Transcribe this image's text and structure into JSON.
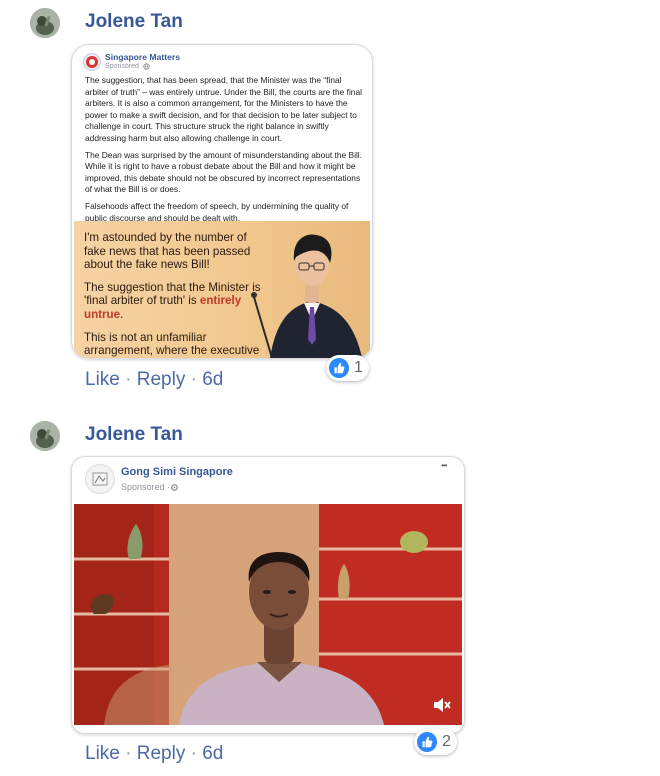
{
  "comments": [
    {
      "author": "Jolene Tan",
      "actions": {
        "like": "Like",
        "reply": "Reply",
        "time": "6d",
        "dot": "·"
      },
      "reaction_count": "1",
      "shared_post": {
        "page_name": "Singapore Matters",
        "sponsored": "Sponsored · ",
        "paragraphs": [
          "The suggestion, that has been spread, that the Minister was the “final arbiter of truth” – was entirely untrue. Under the Bill, the courts are the final arbiters. It is also a common arrangement, for the Ministers to have the power to make a swift decision, and for that decision to be later subject to challenge in court. This structure struck the right balance in swiftly addressing harm but also allowing challenge in court.",
          "The Dean was surprised by the amount of misunderstanding about the Bill. While it is right to have a robust debate about the Bill and how it might be improved, this debate should not be obscured by incorrect representations of what the Bill is or does.",
          "Falsehoods affect the freedom of speech, by undermining the quality of public discourse and should be dealt with."
        ],
        "quote": {
          "p1": "I'm astounded by the number of fake news that has been passed about the fake news Bill!",
          "p2_prefix": "The suggestion that the Minister is 'final arbiter of truth' is ",
          "p2_highlight": "entirely untrue",
          "p2_suffix": ".",
          "p3": "This is not an unfamiliar arrangement, where the executive (branch) has power to make a swift decision, and then the decision can be challenged in court."
        }
      }
    },
    {
      "author": "Jolene Tan",
      "actions": {
        "like": "Like",
        "reply": "Reply",
        "time": "6d",
        "dot": "·"
      },
      "reaction_count": "2",
      "shared_post": {
        "page_name": "Gong Simi Singapore",
        "sponsored": "Sponsored · ",
        "more_label": "•••"
      }
    }
  ],
  "icons": [
    "globe-icon",
    "gear-icon",
    "like-icon",
    "mute-icon",
    "more-icon"
  ],
  "colors": {
    "author": "#385898",
    "like_badge": "#2d88ff",
    "quote_bg": "#f3ca94",
    "video_wall": "#b52a1f"
  }
}
